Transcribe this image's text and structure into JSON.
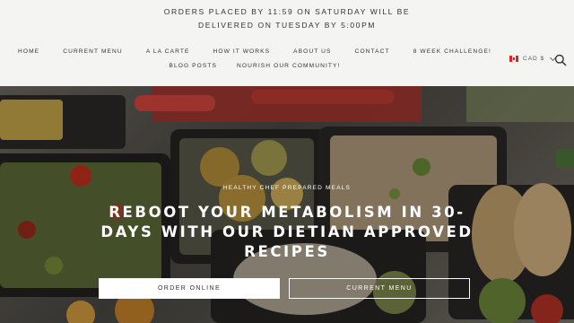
{
  "announcement": {
    "line1": "ORDERS PLACED BY 11:59 ON SATURDAY WILL BE",
    "line2": "DELIVERED ON TUESDAY BY 5:00PM"
  },
  "nav": {
    "row1": [
      "HOME",
      "CURRENT MENU",
      "A LA CARTE",
      "HOW IT WORKS",
      "ABOUT US",
      "CONTACT",
      "8 WEEK CHALLENGE!"
    ],
    "row2": [
      "BLOG POSTS",
      "NOURISH OUR COMMUNITY!"
    ]
  },
  "currency": {
    "label": "CAD $",
    "flag": "canada-flag-icon"
  },
  "icons": {
    "search": "search-icon",
    "chevron": "chevron-down-icon"
  },
  "hero": {
    "eyebrow": "HEALTHY CHEF PREPARED MEALS",
    "headline": "REBOOT YOUR METABOLISM IN 30-DAYS WITH OUR DIETIAN APPROVED RECIPES",
    "primary_button": "ORDER ONLINE",
    "secondary_button": "CURRENT MENU"
  }
}
